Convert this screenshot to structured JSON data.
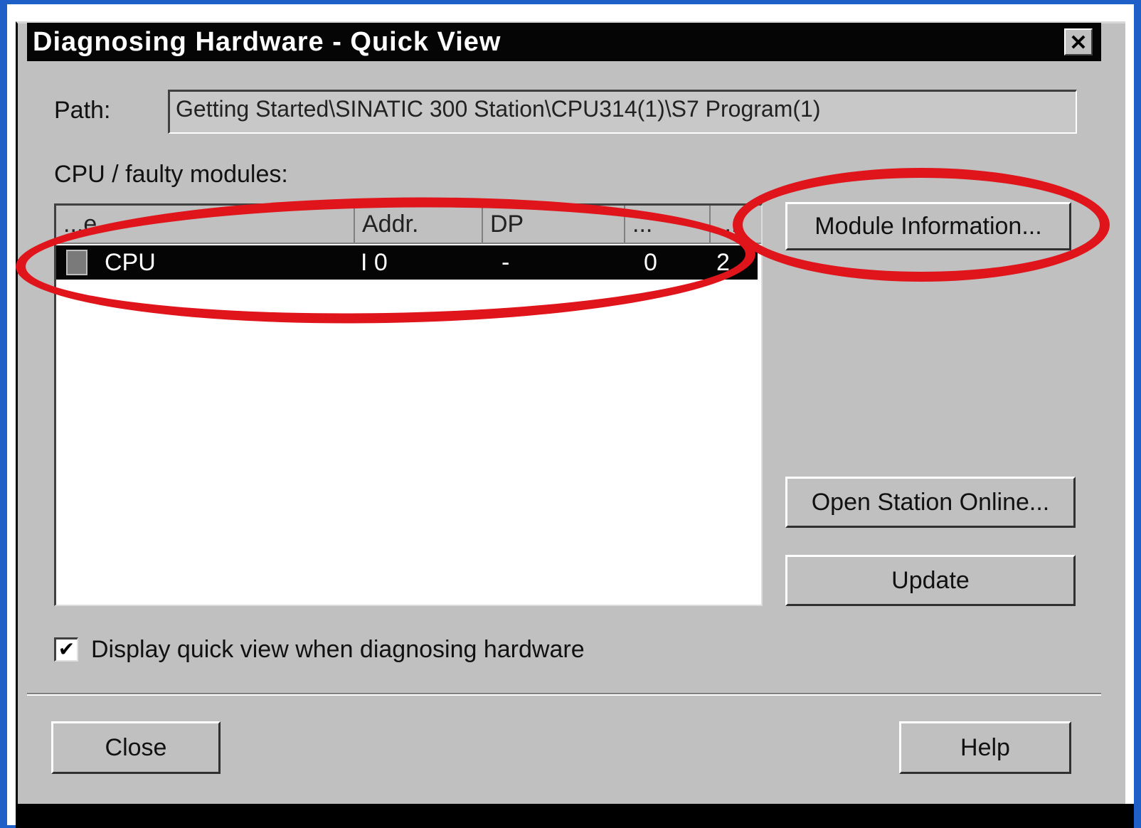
{
  "window": {
    "title": "Diagnosing Hardware - Quick View",
    "close_glyph": "✕"
  },
  "path": {
    "label": "Path:",
    "value": "Getting Started\\SINATIC 300 Station\\CPU314(1)\\S7 Program(1)"
  },
  "modules": {
    "label": "CPU / faulty modules:",
    "columns": [
      "...e",
      "Addr.",
      "DP",
      "...",
      "..."
    ],
    "rows": [
      {
        "icon": "module-icon",
        "name": "CPU",
        "address": "I 0",
        "dp": "-",
        "col4": "0",
        "col5": "2"
      }
    ]
  },
  "buttons": {
    "module_information": "Module Information...",
    "open_station_online": "Open Station Online...",
    "update": "Update",
    "close": "Close",
    "help": "Help"
  },
  "checkbox": {
    "checked": true,
    "glyph": "✔",
    "label": "Display quick view when diagnosing hardware"
  },
  "colors": {
    "highlight": "#e0151b",
    "selection": "#050505",
    "dialog": "#c0c0c0",
    "background": "#1f5fc8"
  }
}
